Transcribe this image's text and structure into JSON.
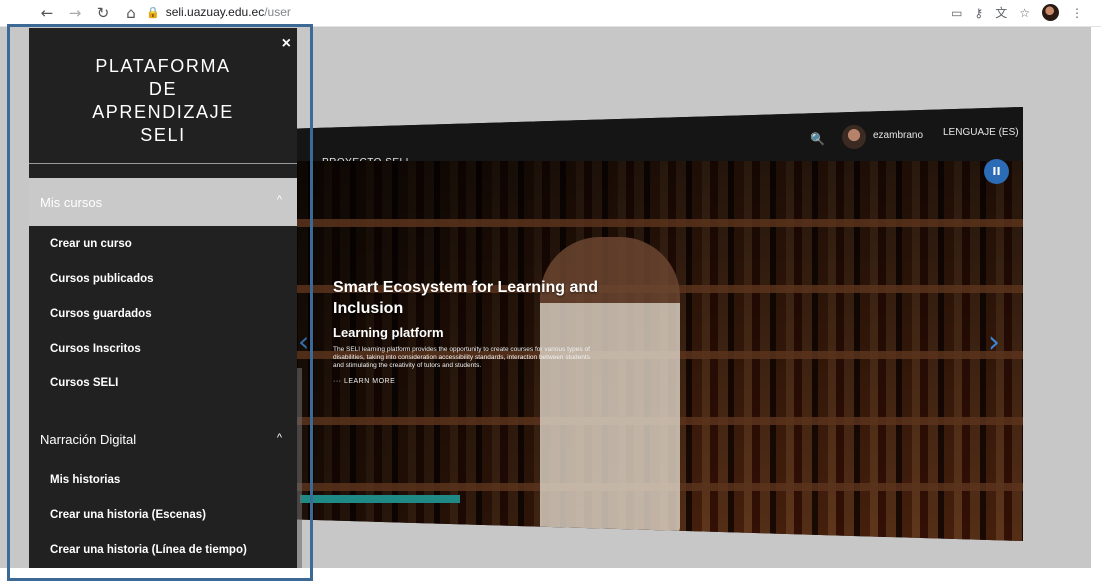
{
  "browser": {
    "url_host": "seli.uazuay.edu.ec",
    "url_path": "/user",
    "icons": [
      "back-icon",
      "forward-icon",
      "reload-icon",
      "home-icon"
    ],
    "right_icons": [
      "cast-icon",
      "key-icon",
      "translate-icon",
      "star-icon",
      "profile-icon",
      "menu-icon"
    ]
  },
  "sidebar": {
    "close_label": "×",
    "brand_lines": [
      "PLATAFORMA",
      "DE",
      "APRENDIZAJE",
      "SELI"
    ],
    "section1": {
      "label": "Mis cursos",
      "caret": "^"
    },
    "section1_items": [
      "Crear un curso",
      "Cursos publicados",
      "Cursos guardados",
      "Cursos Inscritos",
      "Cursos SELI"
    ],
    "section2": {
      "label": "Narración Digital",
      "caret": "^"
    },
    "section2_items": [
      "Mis historias",
      "Crear una historia (Escenas)",
      "Crear una historia (Línea de tiempo)"
    ]
  },
  "topnav": {
    "proyecto": "PROYECTO SELI",
    "user": "ezambrano",
    "language": "LENGUAJE (ES)"
  },
  "slide": {
    "title": "Smart Ecosystem for Learning and Inclusion",
    "subtitle": "Learning platform",
    "description": "The SELI learning platform provides the opportunity to create courses for various types of disabilities, taking into consideration accessibility standards, interaction between students and stimulating the creativity of tutors and students.",
    "learn_more": "LEARN MORE",
    "pause": "II",
    "next": "›",
    "prev": "‹"
  },
  "colors": {
    "sidebar_bg": "#212121",
    "active_section": "#c9c9c9",
    "accent_blue": "#2c6bb5",
    "annotation_box": "#3c6996"
  }
}
